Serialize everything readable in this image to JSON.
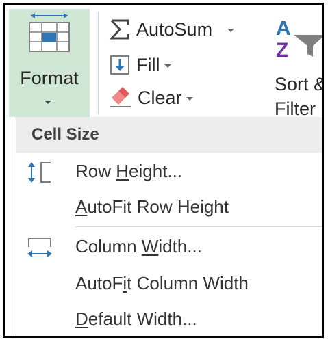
{
  "ribbon": {
    "format": {
      "label": "Format",
      "icon": "format-cells-icon"
    },
    "autosum": {
      "label": "AutoSum",
      "icon": "sigma-icon"
    },
    "fill": {
      "label": "Fill",
      "icon": "fill-down-icon"
    },
    "clear": {
      "label": "Clear",
      "icon": "eraser-icon"
    },
    "sort_filter": {
      "line1": "Sort &",
      "line2": "Filter",
      "icon": "sort-az-filter-icon"
    }
  },
  "menu": {
    "header": "Cell Size",
    "items": [
      {
        "pre": "Row ",
        "key": "H",
        "post": "eight...",
        "icon": "row-height-icon"
      },
      {
        "pre": "",
        "key": "A",
        "post": "utoFit Row Height",
        "icon": ""
      },
      {
        "pre": "Column ",
        "key": "W",
        "post": "idth...",
        "icon": "column-width-icon"
      },
      {
        "pre": "AutoF",
        "key": "i",
        "post": "t Column Width",
        "icon": ""
      },
      {
        "pre": "",
        "key": "D",
        "post": "efault Width...",
        "icon": ""
      }
    ]
  },
  "colors": {
    "format_active_bg": "#cfe6d4",
    "menu_header_bg": "#ededed",
    "accent_blue": "#2e75b6"
  }
}
